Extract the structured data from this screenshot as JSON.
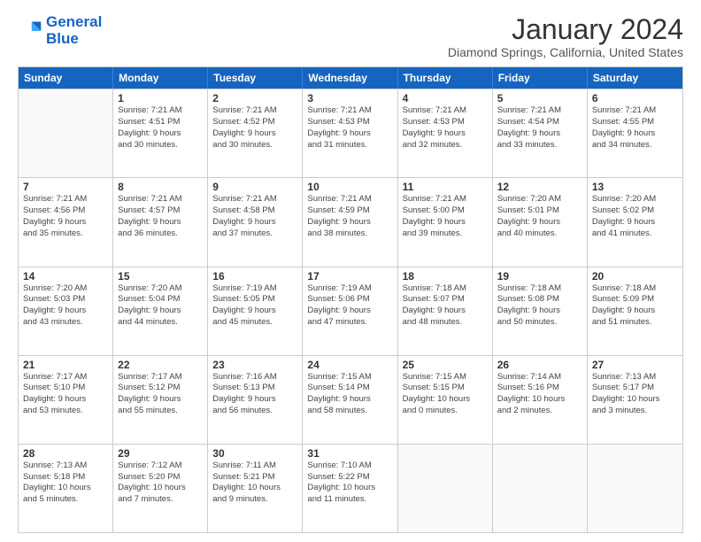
{
  "logo": {
    "line1": "General",
    "line2": "Blue"
  },
  "title": "January 2024",
  "location": "Diamond Springs, California, United States",
  "days_header": [
    "Sunday",
    "Monday",
    "Tuesday",
    "Wednesday",
    "Thursday",
    "Friday",
    "Saturday"
  ],
  "weeks": [
    [
      {
        "day": "",
        "info": ""
      },
      {
        "day": "1",
        "info": "Sunrise: 7:21 AM\nSunset: 4:51 PM\nDaylight: 9 hours\nand 30 minutes."
      },
      {
        "day": "2",
        "info": "Sunrise: 7:21 AM\nSunset: 4:52 PM\nDaylight: 9 hours\nand 30 minutes."
      },
      {
        "day": "3",
        "info": "Sunrise: 7:21 AM\nSunset: 4:53 PM\nDaylight: 9 hours\nand 31 minutes."
      },
      {
        "day": "4",
        "info": "Sunrise: 7:21 AM\nSunset: 4:53 PM\nDaylight: 9 hours\nand 32 minutes."
      },
      {
        "day": "5",
        "info": "Sunrise: 7:21 AM\nSunset: 4:54 PM\nDaylight: 9 hours\nand 33 minutes."
      },
      {
        "day": "6",
        "info": "Sunrise: 7:21 AM\nSunset: 4:55 PM\nDaylight: 9 hours\nand 34 minutes."
      }
    ],
    [
      {
        "day": "7",
        "info": "Sunrise: 7:21 AM\nSunset: 4:56 PM\nDaylight: 9 hours\nand 35 minutes."
      },
      {
        "day": "8",
        "info": "Sunrise: 7:21 AM\nSunset: 4:57 PM\nDaylight: 9 hours\nand 36 minutes."
      },
      {
        "day": "9",
        "info": "Sunrise: 7:21 AM\nSunset: 4:58 PM\nDaylight: 9 hours\nand 37 minutes."
      },
      {
        "day": "10",
        "info": "Sunrise: 7:21 AM\nSunset: 4:59 PM\nDaylight: 9 hours\nand 38 minutes."
      },
      {
        "day": "11",
        "info": "Sunrise: 7:21 AM\nSunset: 5:00 PM\nDaylight: 9 hours\nand 39 minutes."
      },
      {
        "day": "12",
        "info": "Sunrise: 7:20 AM\nSunset: 5:01 PM\nDaylight: 9 hours\nand 40 minutes."
      },
      {
        "day": "13",
        "info": "Sunrise: 7:20 AM\nSunset: 5:02 PM\nDaylight: 9 hours\nand 41 minutes."
      }
    ],
    [
      {
        "day": "14",
        "info": "Sunrise: 7:20 AM\nSunset: 5:03 PM\nDaylight: 9 hours\nand 43 minutes."
      },
      {
        "day": "15",
        "info": "Sunrise: 7:20 AM\nSunset: 5:04 PM\nDaylight: 9 hours\nand 44 minutes."
      },
      {
        "day": "16",
        "info": "Sunrise: 7:19 AM\nSunset: 5:05 PM\nDaylight: 9 hours\nand 45 minutes."
      },
      {
        "day": "17",
        "info": "Sunrise: 7:19 AM\nSunset: 5:06 PM\nDaylight: 9 hours\nand 47 minutes."
      },
      {
        "day": "18",
        "info": "Sunrise: 7:18 AM\nSunset: 5:07 PM\nDaylight: 9 hours\nand 48 minutes."
      },
      {
        "day": "19",
        "info": "Sunrise: 7:18 AM\nSunset: 5:08 PM\nDaylight: 9 hours\nand 50 minutes."
      },
      {
        "day": "20",
        "info": "Sunrise: 7:18 AM\nSunset: 5:09 PM\nDaylight: 9 hours\nand 51 minutes."
      }
    ],
    [
      {
        "day": "21",
        "info": "Sunrise: 7:17 AM\nSunset: 5:10 PM\nDaylight: 9 hours\nand 53 minutes."
      },
      {
        "day": "22",
        "info": "Sunrise: 7:17 AM\nSunset: 5:12 PM\nDaylight: 9 hours\nand 55 minutes."
      },
      {
        "day": "23",
        "info": "Sunrise: 7:16 AM\nSunset: 5:13 PM\nDaylight: 9 hours\nand 56 minutes."
      },
      {
        "day": "24",
        "info": "Sunrise: 7:15 AM\nSunset: 5:14 PM\nDaylight: 9 hours\nand 58 minutes."
      },
      {
        "day": "25",
        "info": "Sunrise: 7:15 AM\nSunset: 5:15 PM\nDaylight: 10 hours\nand 0 minutes."
      },
      {
        "day": "26",
        "info": "Sunrise: 7:14 AM\nSunset: 5:16 PM\nDaylight: 10 hours\nand 2 minutes."
      },
      {
        "day": "27",
        "info": "Sunrise: 7:13 AM\nSunset: 5:17 PM\nDaylight: 10 hours\nand 3 minutes."
      }
    ],
    [
      {
        "day": "28",
        "info": "Sunrise: 7:13 AM\nSunset: 5:18 PM\nDaylight: 10 hours\nand 5 minutes."
      },
      {
        "day": "29",
        "info": "Sunrise: 7:12 AM\nSunset: 5:20 PM\nDaylight: 10 hours\nand 7 minutes."
      },
      {
        "day": "30",
        "info": "Sunrise: 7:11 AM\nSunset: 5:21 PM\nDaylight: 10 hours\nand 9 minutes."
      },
      {
        "day": "31",
        "info": "Sunrise: 7:10 AM\nSunset: 5:22 PM\nDaylight: 10 hours\nand 11 minutes."
      },
      {
        "day": "",
        "info": ""
      },
      {
        "day": "",
        "info": ""
      },
      {
        "day": "",
        "info": ""
      }
    ]
  ]
}
